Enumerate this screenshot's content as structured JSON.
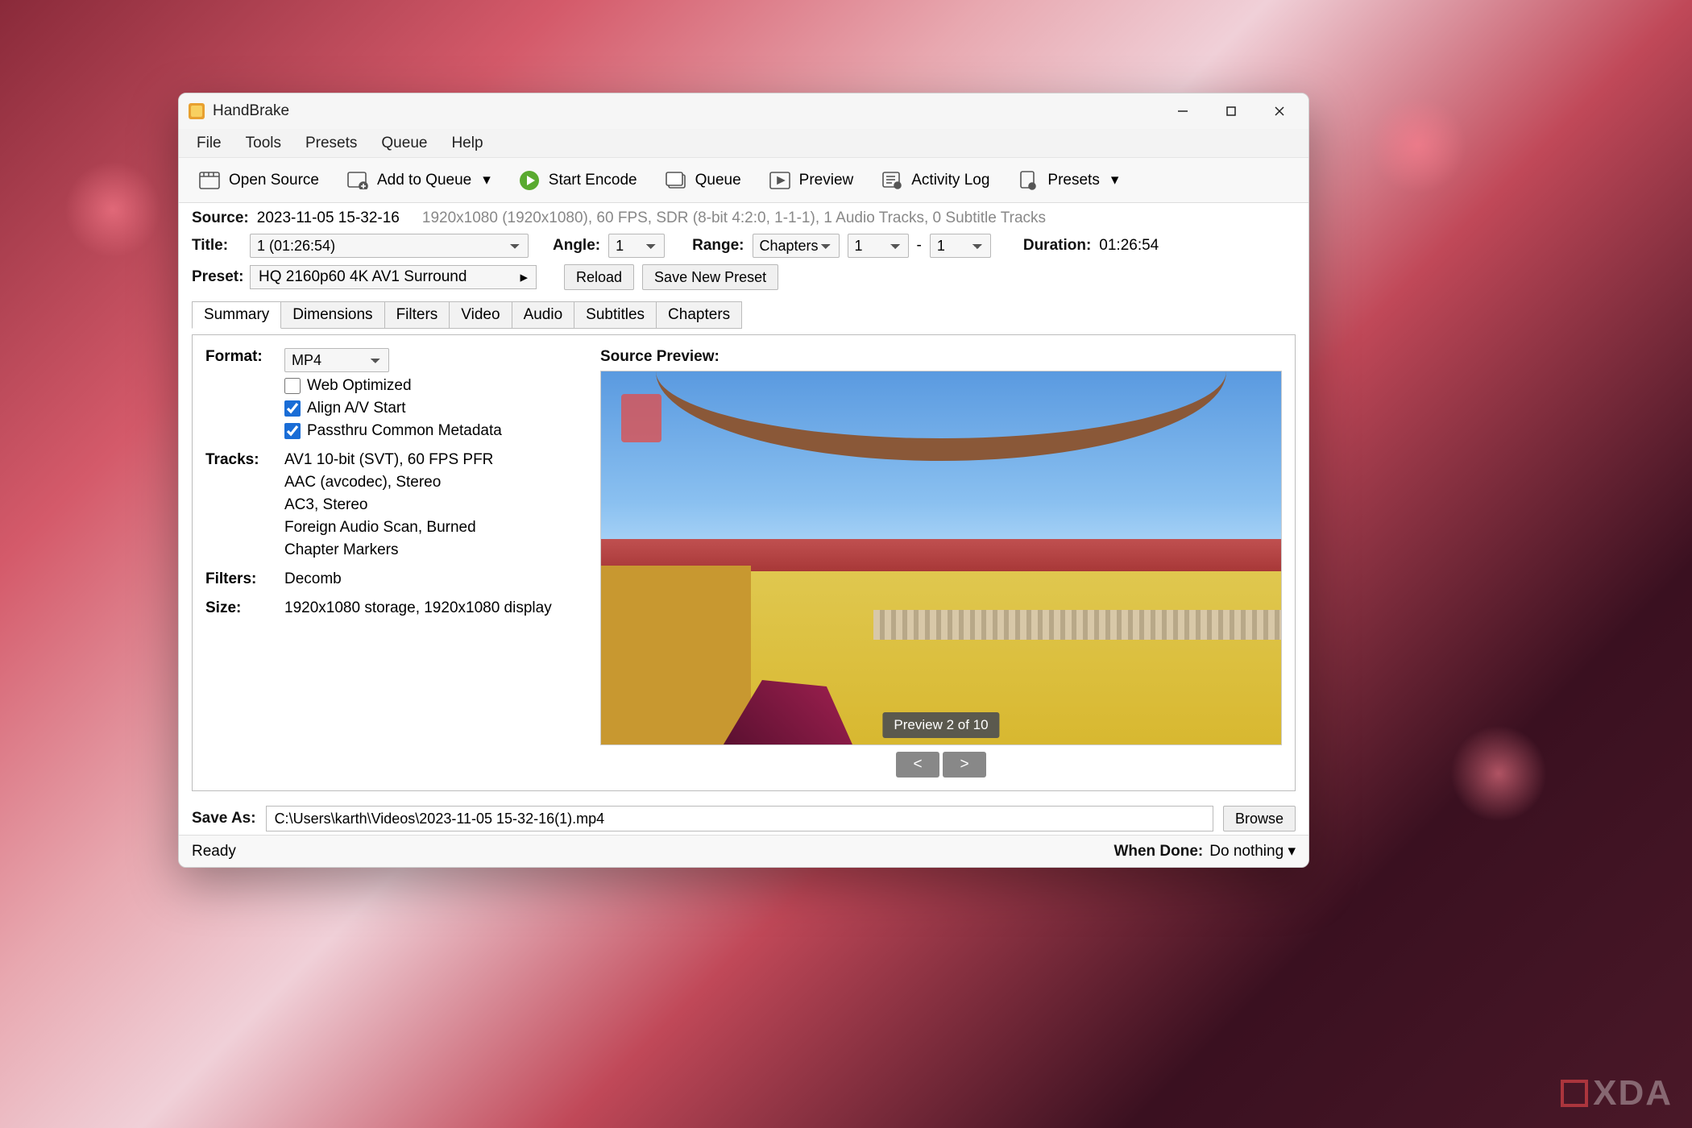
{
  "app": {
    "title": "HandBrake"
  },
  "menubar": [
    "File",
    "Tools",
    "Presets",
    "Queue",
    "Help"
  ],
  "toolbar": {
    "open_source": "Open Source",
    "add_to_queue": "Add to Queue",
    "start_encode": "Start Encode",
    "queue": "Queue",
    "preview": "Preview",
    "activity_log": "Activity Log",
    "presets": "Presets"
  },
  "source": {
    "label": "Source:",
    "name": "2023-11-05 15-32-16",
    "meta": "1920x1080 (1920x1080), 60 FPS, SDR (8-bit 4:2:0, 1-1-1), 1 Audio Tracks, 0 Subtitle Tracks"
  },
  "titleRow": {
    "title_label": "Title:",
    "title_value": "1  (01:26:54)",
    "angle_label": "Angle:",
    "angle_value": "1",
    "range_label": "Range:",
    "range_mode": "Chapters",
    "range_from": "1",
    "range_to": "1",
    "duration_label": "Duration:",
    "duration_value": "01:26:54"
  },
  "presetRow": {
    "label": "Preset:",
    "value": "HQ 2160p60 4K AV1 Surround",
    "reload": "Reload",
    "save_new": "Save New Preset"
  },
  "tabs": [
    "Summary",
    "Dimensions",
    "Filters",
    "Video",
    "Audio",
    "Subtitles",
    "Chapters"
  ],
  "summary": {
    "format_label": "Format:",
    "format_value": "MP4",
    "web_optimized": "Web Optimized",
    "align_av": "Align A/V Start",
    "passthru": "Passthru Common Metadata",
    "tracks_label": "Tracks:",
    "tracks": [
      "AV1 10-bit (SVT), 60 FPS PFR",
      "AAC (avcodec), Stereo",
      "AC3, Stereo",
      "Foreign Audio Scan, Burned",
      "Chapter Markers"
    ],
    "filters_label": "Filters:",
    "filters_value": "Decomb",
    "size_label": "Size:",
    "size_value": "1920x1080 storage, 1920x1080 display",
    "preview_label": "Source Preview:",
    "preview_badge": "Preview 2 of 10"
  },
  "save_as": {
    "label": "Save As:",
    "path": "C:\\Users\\karth\\Videos\\2023-11-05 15-32-16(1).mp4",
    "browse": "Browse"
  },
  "statusbar": {
    "status": "Ready",
    "when_done_label": "When Done:",
    "when_done_value": "Do nothing"
  },
  "watermark": "XDA"
}
